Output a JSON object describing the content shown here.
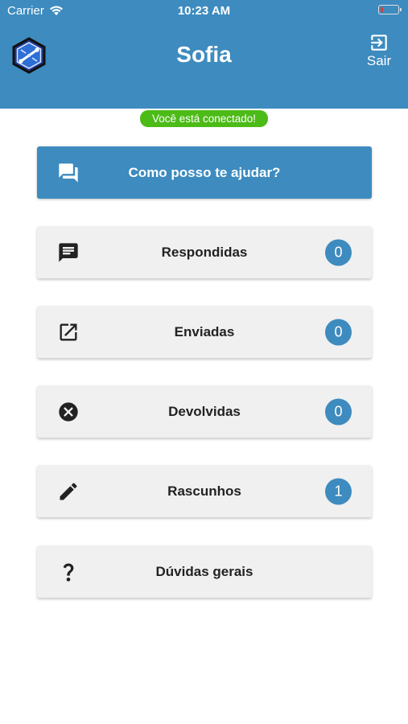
{
  "status_bar": {
    "carrier": "Carrier",
    "time": "10:23 AM",
    "battery_color": "#e53935"
  },
  "header": {
    "title": "Sofia",
    "logout_label": "Sair",
    "logout_icon": "exit-icon",
    "logo_icon": "hexagon-logo-icon",
    "background": "#3d8bbf"
  },
  "connection": {
    "text": "Você está conectado!",
    "color": "#4cbb17"
  },
  "menu": {
    "help": {
      "label": "Como posso te ajudar?",
      "icon": "chat-bubbles-icon"
    },
    "items": [
      {
        "label": "Respondidas",
        "count": "0",
        "icon": "message-icon"
      },
      {
        "label": "Enviadas",
        "count": "0",
        "icon": "open-in-new-icon"
      },
      {
        "label": "Devolvidas",
        "count": "0",
        "icon": "cancel-circle-icon"
      },
      {
        "label": "Rascunhos",
        "count": "1",
        "icon": "pencil-icon"
      },
      {
        "label": "Dúvidas gerais",
        "icon": "question-mark-icon"
      }
    ]
  }
}
